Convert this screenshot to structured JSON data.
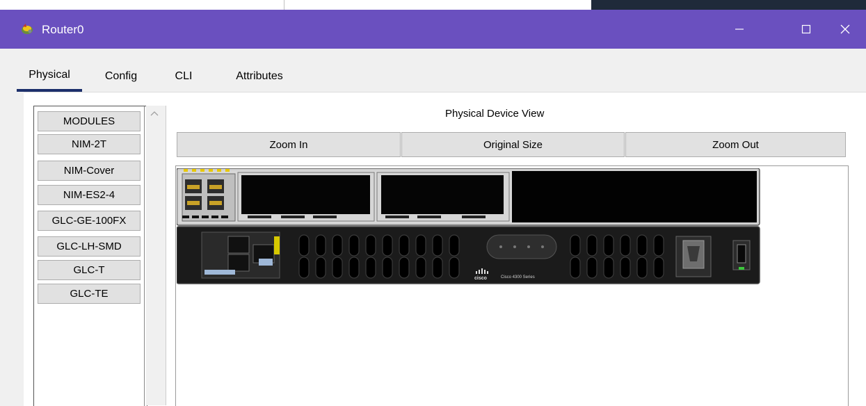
{
  "window": {
    "title": "Router0",
    "icon": "router-app-icon",
    "minimize_label": "",
    "maximize_label": "",
    "close_label": ""
  },
  "tabs": [
    {
      "label": "Physical",
      "active": true
    },
    {
      "label": "Config",
      "active": false
    },
    {
      "label": "CLI",
      "active": false
    },
    {
      "label": "Attributes",
      "active": false
    }
  ],
  "modules": {
    "items": [
      "MODULES",
      "NIM-2T",
      "NIM-Cover",
      "NIM-ES2-4",
      "GLC-GE-100FX",
      "GLC-LH-SMD",
      "GLC-T",
      "GLC-TE"
    ]
  },
  "device_view": {
    "title": "Physical Device View",
    "zoom_in": "Zoom In",
    "original_size": "Original Size",
    "zoom_out": "Zoom Out"
  },
  "device": {
    "brand": "cisco",
    "model_label": "Cisco 4300 Series",
    "console_label": "CONSOLE",
    "led_labels": [
      "PSOE",
      "FLASH",
      "TEMP",
      "PWR",
      "SSD",
      "SEL",
      "VSA",
      "STAT"
    ]
  },
  "colors": {
    "titlebar": "#6a50bf",
    "tab_underline": "#1c2f6b",
    "button_face": "#e1e1e1"
  }
}
